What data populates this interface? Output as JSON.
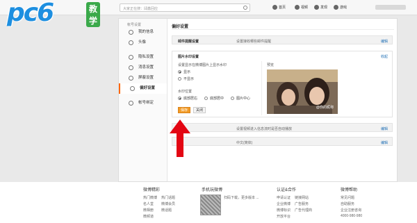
{
  "logo": {
    "brand": "pc6",
    "badge": "教学"
  },
  "topbar": {
    "search_placeholder": "大家正在搜：邱鑫回应",
    "nav": [
      {
        "icon": "home-icon",
        "label": "首页"
      },
      {
        "icon": "video-icon",
        "label": "视频"
      },
      {
        "icon": "discover-icon",
        "label": "发现"
      },
      {
        "icon": "game-icon",
        "label": "游戏"
      }
    ]
  },
  "sidebar": {
    "section": "帐号设置",
    "items": [
      {
        "icon": "profile-icon",
        "label": "我的信息"
      },
      {
        "icon": "avatar-icon",
        "label": "头像"
      },
      {
        "icon": "privacy-icon",
        "label": "隐私设置"
      },
      {
        "icon": "message-icon",
        "label": "消息设置"
      },
      {
        "icon": "block-icon",
        "label": "屏蔽设置"
      },
      {
        "icon": "preferences-icon",
        "label": "偏好设置"
      },
      {
        "icon": "bind-icon",
        "label": "帐号绑定"
      }
    ]
  },
  "content": {
    "title": "偏好设置",
    "rows": [
      {
        "label": "邮件提醒设置",
        "desc": "设置接收哪些邮件提醒",
        "edit": "编辑"
      },
      {
        "label": "",
        "desc": "设置视频进入信息流时是否自动播放",
        "edit": "编辑"
      },
      {
        "label": "",
        "desc": "中文(简体)",
        "edit": "编辑"
      }
    ],
    "watermark": {
      "title": "图片水印设置",
      "collapse": "收起",
      "desc": "设置显示在微博图片上显示水印",
      "show": "显示",
      "hide": "不显示",
      "position_label": "水印位置",
      "positions": [
        "底部居右",
        "底部居中",
        "图片中心"
      ],
      "save": "保存",
      "close": "关闭",
      "preview_label": "预览",
      "preview_mark": "@你的昵称"
    }
  },
  "footer": {
    "cols": [
      {
        "title": "微博精彩",
        "links": [
          "热门微博",
          "热门话题",
          "名人堂",
          "微博会员",
          "微相册",
          "微话题",
          "微频道",
          ""
        ]
      },
      {
        "title": "手机玩微博",
        "links": []
      },
      {
        "title": "认证&合作",
        "links": [
          "申请认证",
          "链接网站",
          "企业微博",
          "广告服务",
          "微博标识",
          "广告代理商",
          "开放平台",
          ""
        ]
      },
      {
        "title": "微博帮助",
        "links": [
          "常见问题",
          "自助服务",
          "企业注册咨询",
          "4000-980-980"
        ]
      }
    ],
    "qr_text": "扫码下载，更多版本 ..."
  },
  "colors": {
    "accent": "#f29b26",
    "link": "#1f6fb5",
    "arrow": "#e30613",
    "brand": "#1e8fe0"
  }
}
